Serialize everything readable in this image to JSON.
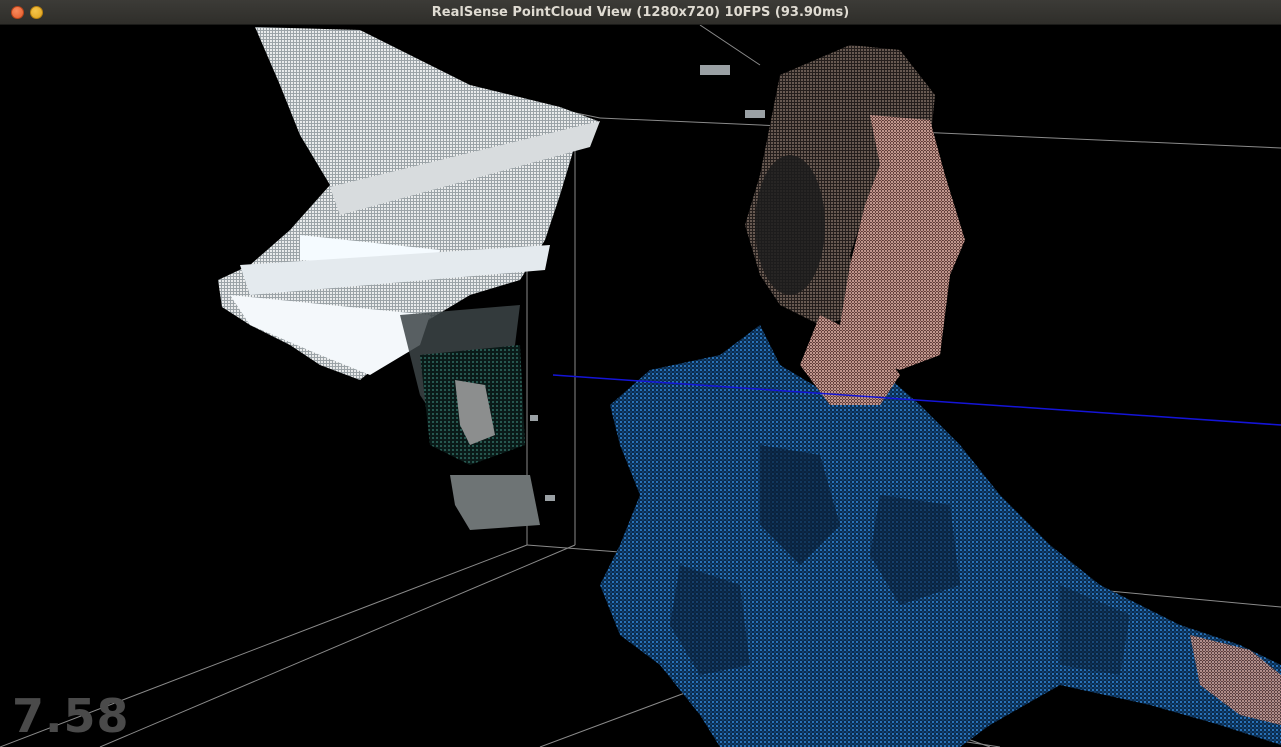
{
  "window": {
    "title": "RealSense PointCloud View (1280x720) 10FPS (93.90ms)"
  },
  "overlay": {
    "value": "7.58"
  },
  "colors": {
    "background": "#000000",
    "grid_line": "#8a8a8a",
    "axis_line": "#1414d8",
    "shirt_blue": "#1f5f9e",
    "skin": "#d9a8a0",
    "hair": "#6a5a52",
    "ceiling_white": "#e8eef2"
  },
  "scene": {
    "description_icons": [
      "point-cloud"
    ]
  }
}
